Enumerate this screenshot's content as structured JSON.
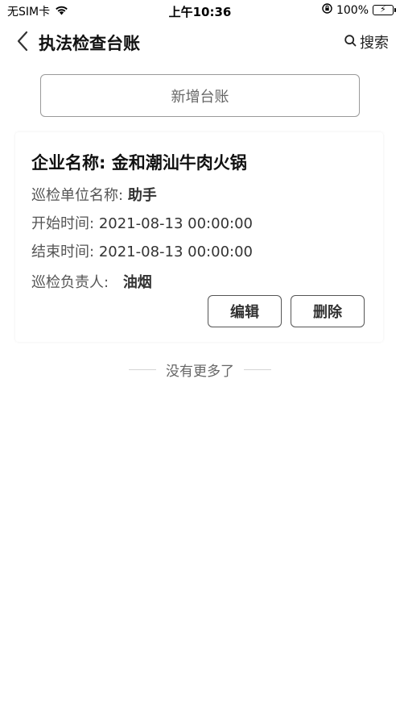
{
  "status_bar": {
    "carrier": "无SIM卡",
    "time": "上午10:36",
    "battery": "100%"
  },
  "nav": {
    "title": "执法检查台账",
    "search_label": "搜索"
  },
  "add_button_label": "新增台账",
  "record": {
    "company": "企业名称: 金和潮汕牛肉火锅",
    "unit_label": "巡检单位名称:",
    "unit_value": "助手",
    "start_label": "开始时间:",
    "start_value": "2021-08-13 00:00:00",
    "end_label": "结束时间:",
    "end_value": "2021-08-13 00:00:00",
    "person_label": "巡检负责人:",
    "person_value": "油烟",
    "edit_label": "编辑",
    "delete_label": "删除"
  },
  "footer_text": "没有更多了",
  "colors": {
    "battery_green": "#34c759",
    "text_primary": "#111111",
    "text_secondary": "#555555"
  }
}
